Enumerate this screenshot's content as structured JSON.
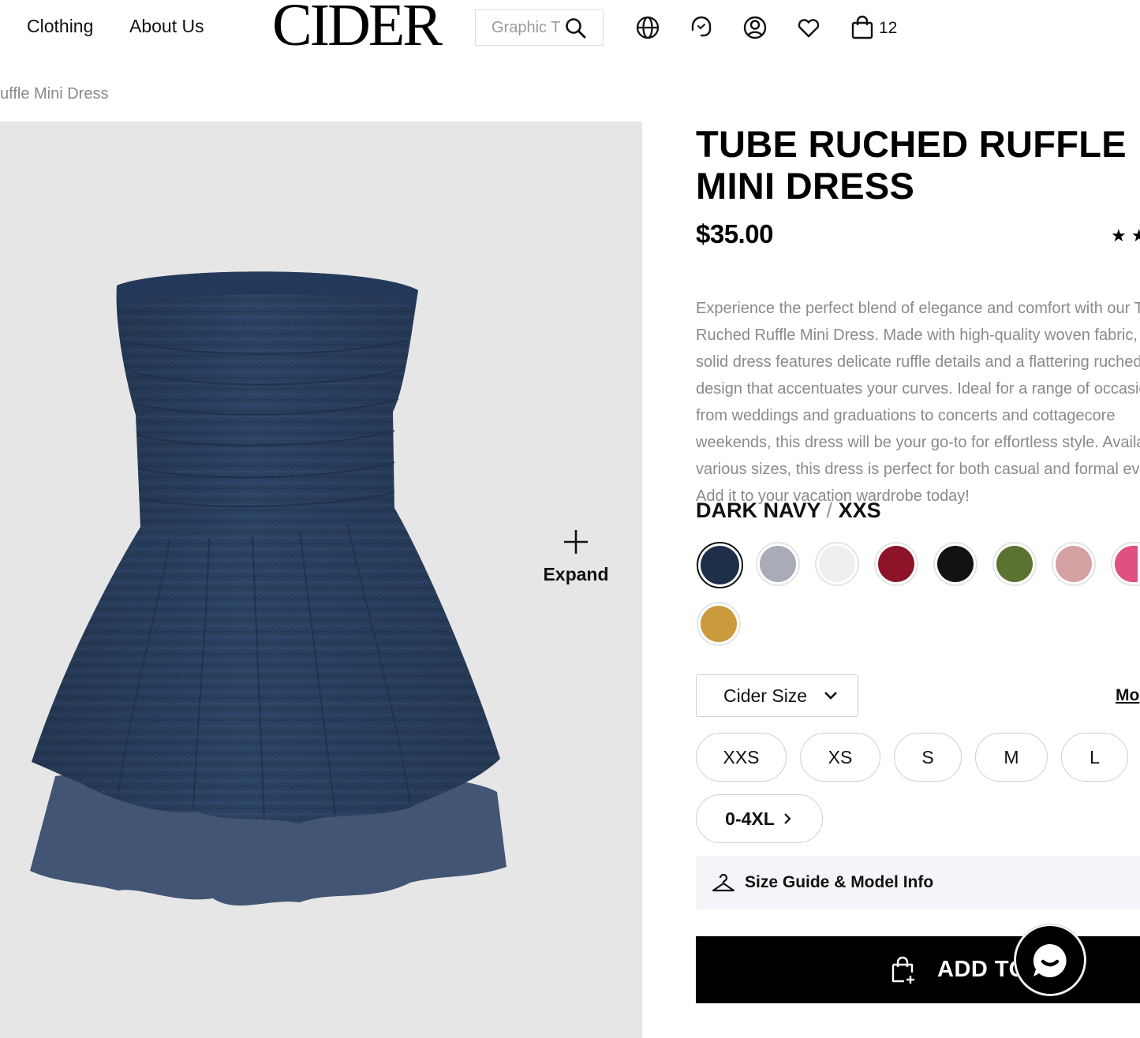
{
  "header": {
    "nav": [
      "Clothing",
      "About Us"
    ],
    "logo": "CIDER",
    "search_placeholder": "Graphic T",
    "bag_count": "12"
  },
  "breadcrumb": "uffle Mini Dress",
  "gallery": {
    "expand_label": "Expand"
  },
  "product": {
    "title": "TUBE RUCHED RUFFLE MINI DRESS",
    "price": "$35.00",
    "rating_stars": "★ ★",
    "description": "Experience the perfect blend of elegance and comfort with our Tube Ruched Ruffle Mini Dress. Made with high-quality woven fabric, this solid dress features delicate ruffle details and a flattering ruched design that accentuates your curves. Ideal for a range of occasions, from weddings and graduations to concerts and cottagecore weekends, this dress will be your go-to for effortless style. Available in various sizes, this dress is perfect for both casual and formal events. Add it to your vacation wardrobe today!",
    "selected_color": "DARK NAVY",
    "selected_size": "XXS",
    "swatches": [
      {
        "color": "#1e2f4a"
      },
      {
        "color": "#a9abb9"
      },
      {
        "color": "#efefef"
      },
      {
        "color": "#8d1327"
      },
      {
        "color": "#121212"
      },
      {
        "color": "#5b7330"
      },
      {
        "color": "#d4a2a3"
      },
      {
        "color": "#e0517f"
      },
      {
        "color": "#c99a3e"
      }
    ],
    "size_system": "Cider Size",
    "more_link": "Mo",
    "sizes": [
      "XXS",
      "XS",
      "S",
      "M",
      "L"
    ],
    "plus_sizes": "0-4XL",
    "size_guide": "Size Guide & Model Info",
    "add_to_cart": "ADD TO"
  },
  "colors": {
    "dress": "#2b4262",
    "panel": "#e6e6e6",
    "accent": "#000000"
  }
}
